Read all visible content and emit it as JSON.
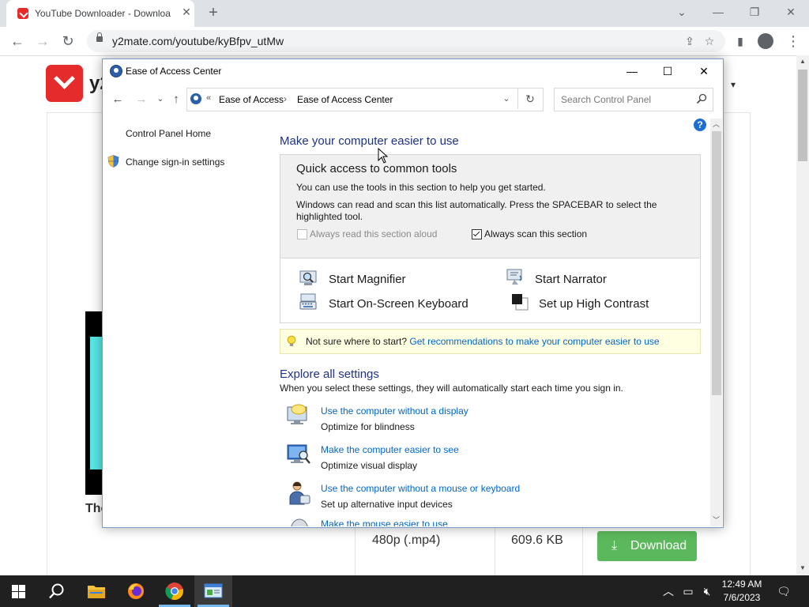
{
  "browser": {
    "tab_title": "YouTube Downloader - Downloa",
    "url": "y2mate.com/youtube/kyBfpv_utMw",
    "new_tab_glyph": "+",
    "tab_close_glyph": "✕",
    "icons": [
      "back-icon",
      "forward-icon",
      "reload-icon",
      "lock-icon",
      "share-icon",
      "star-icon",
      "sidebar-icon",
      "profile-icon",
      "menu-icon"
    ]
  },
  "page": {
    "logo_text": "y2",
    "video_title": "The",
    "row": {
      "quality": "480p (.mp4)",
      "size": "609.6 KB",
      "button": "Download"
    }
  },
  "window": {
    "title": "Ease of Access Center",
    "breadcrumb": [
      "Ease of Access",
      "Ease of Access Center"
    ],
    "breadcrumb_prefix": "«",
    "breadcrumb_separator": "›",
    "search_placeholder": "Search Control Panel",
    "help_glyph": "?",
    "sidebar": [
      "Control Panel Home",
      "Change sign-in settings"
    ],
    "heading": "Make your computer easier to use",
    "quick_access": {
      "title": "Quick access to common tools",
      "line1": "You can use the tools in this section to help you get started.",
      "line2": "Windows can read and scan this list automatically.  Press the SPACEBAR to select the highlighted tool.",
      "checkbox_read": {
        "label": "Always read this section aloud",
        "checked": false,
        "disabled": true
      },
      "checkbox_scan": {
        "label": "Always scan this section",
        "checked": true,
        "disabled": false
      },
      "tools": [
        "Start Magnifier",
        "Start Narrator",
        "Start On-Screen Keyboard",
        "Set up High Contrast"
      ]
    },
    "tip": {
      "prefix": "Not sure where to start?",
      "link": "Get recommendations to make your computer easier to use"
    },
    "explore": {
      "heading": "Explore all settings",
      "subtitle": "When you select these settings, they will automatically start each time you sign in.",
      "items": [
        {
          "link": "Use the computer without a display",
          "desc": "Optimize for blindness"
        },
        {
          "link": "Make the computer easier to see",
          "desc": "Optimize visual display"
        },
        {
          "link": "Use the computer without a mouse or keyboard",
          "desc": "Set up alternative input devices"
        },
        {
          "link": "Make the mouse easier to use",
          "desc": ""
        }
      ]
    }
  },
  "taskbar": {
    "time": "12:49 AM",
    "date": "7/6/2023",
    "items": [
      "start-icon",
      "search-icon",
      "file-explorer-icon",
      "firefox-icon",
      "chrome-icon",
      "control-panel-icon"
    ]
  },
  "colors": {
    "link": "#0066cc",
    "heading": "#1e3287",
    "download_green": "#5cb85c",
    "brand_red": "#e62b2b",
    "taskbar": "#202020"
  }
}
